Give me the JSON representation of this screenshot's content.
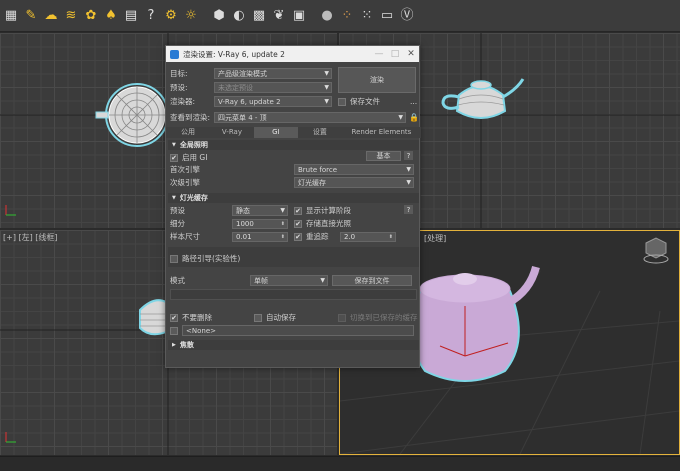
{
  "toolbar": {
    "icons": [
      "folder-icon",
      "lamp-icon",
      "cloud-icon",
      "wave-icon",
      "flower-icon",
      "bird-icon",
      "document-icon",
      "help-icon",
      "gear-icon",
      "sun-icon",
      "box-icon",
      "sphere-icon",
      "checker-icon",
      "leaf-icon",
      "filter-icon",
      "ball-icon",
      "particles-icon",
      "dots-icon",
      "monitor-icon",
      "vray-icon"
    ]
  },
  "viewports": {
    "bottom_left_label": "[+] [左] [线框]",
    "bottom_right_label": "[处理]"
  },
  "dialog": {
    "title": "渲染设置: V-Ray 6, update 2",
    "minimize": "—",
    "maximize": "□",
    "close": "✕",
    "target_label": "目标:",
    "target_value": "产品级渲染模式",
    "preset_label": "预设:",
    "preset_value": "未选定预设",
    "renderer_label": "渲染器:",
    "renderer_value": "V-Ray 6, update 2",
    "render_button": "渲染",
    "save_file_label": "保存文件",
    "more": "...",
    "view_label": "查看到渲染:",
    "view_value": "四元菜单 4 - 顶",
    "tabs": [
      "公用",
      "V-Ray",
      "GI",
      "设置",
      "Render Elements"
    ],
    "active_tab": "GI",
    "gi_section": {
      "title": "全局照明",
      "enable_label": "启用 GI",
      "mode_button": "基本",
      "primary_label": "首次引擎",
      "primary_value": "Brute force",
      "secondary_label": "次级引擎",
      "secondary_value": "灯光缓存"
    },
    "lc_section": {
      "title": "灯光缓存",
      "preset_label": "预设",
      "preset_value": "静态",
      "show_calc_label": "显示计算阶段",
      "subdivs_label": "细分",
      "subdivs_value": "1000",
      "store_direct_label": "存储直接光照",
      "sample_size_label": "样本尺寸",
      "sample_size_value": "0.01",
      "retrace_label": "重追踪",
      "retrace_value": "2.0",
      "path_guide_label": "路径引导(实验性)",
      "mode_label": "模式",
      "mode_value": "单帧",
      "save_button": "保存到文件",
      "dont_delete_label": "不要删除",
      "auto_save_label": "自动保存",
      "switch_saved_label": "切换到已保存的缓存",
      "file_value": "<None>"
    },
    "caustics_section": {
      "title": "焦散"
    }
  }
}
